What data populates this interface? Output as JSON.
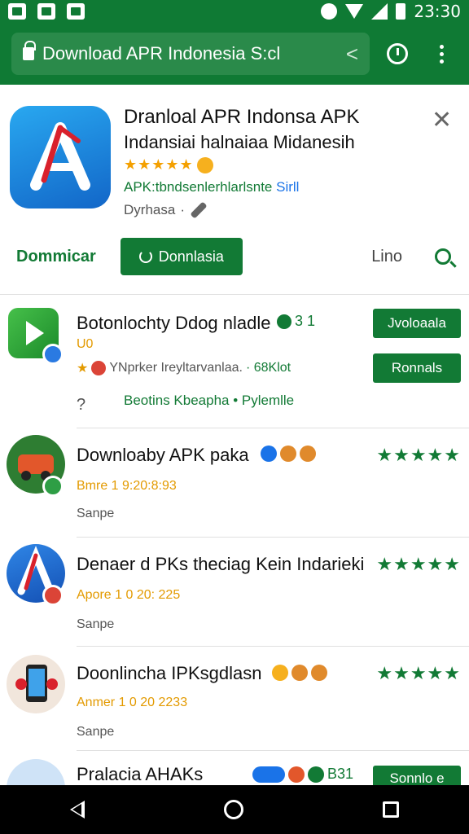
{
  "status_bar": {
    "time": "23:30"
  },
  "toolbar": {
    "url": "Download APR Indonesia S:cl"
  },
  "app": {
    "title": "Dranloal APR Indonsa APK",
    "subtitle": "Indansiai halnaiaa Midanesih",
    "stars": "★★★★★",
    "developer": "APK:tbndsenlerhlarlsnte",
    "developer_suffix": "Sirll",
    "category": "Dyrhasa",
    "download_label": "Dommicar",
    "install_label": "Donnlasia",
    "link_label": "Lino",
    "accent": "#127a35"
  },
  "items": [
    {
      "title": "Botonlochty Ddog nladle",
      "title_suffix": "3 1",
      "sub_prefix": "U0",
      "meta": "YNprker Ireyltarvanlaa.",
      "meta_suffix": "· 68Klot",
      "question": "?",
      "tags": "Beotins  Kbeapha  •  Pylemlle",
      "btn1": "Jvoloaala",
      "btn2": "Ronnals"
    },
    {
      "title": "Downloaby APK paka",
      "meta": "Bmre 1 9:20:8:93",
      "sub": "Sanpe",
      "stars": "★★★★★"
    },
    {
      "title": "Denaer d PKs theciag Kein Indarieki",
      "meta": "Apore 1 0 20: 225",
      "sub": "Sanpe",
      "stars": "★★★★★"
    },
    {
      "title": "Doonlincha IPKsgdlasn",
      "meta": "Anmer 1 0 20 2233",
      "sub": "Sanpe",
      "stars": "★★★★★"
    },
    {
      "title": "Pralacia AHAKs",
      "badge_text": "B31",
      "btn": "Sonnlo e"
    }
  ]
}
